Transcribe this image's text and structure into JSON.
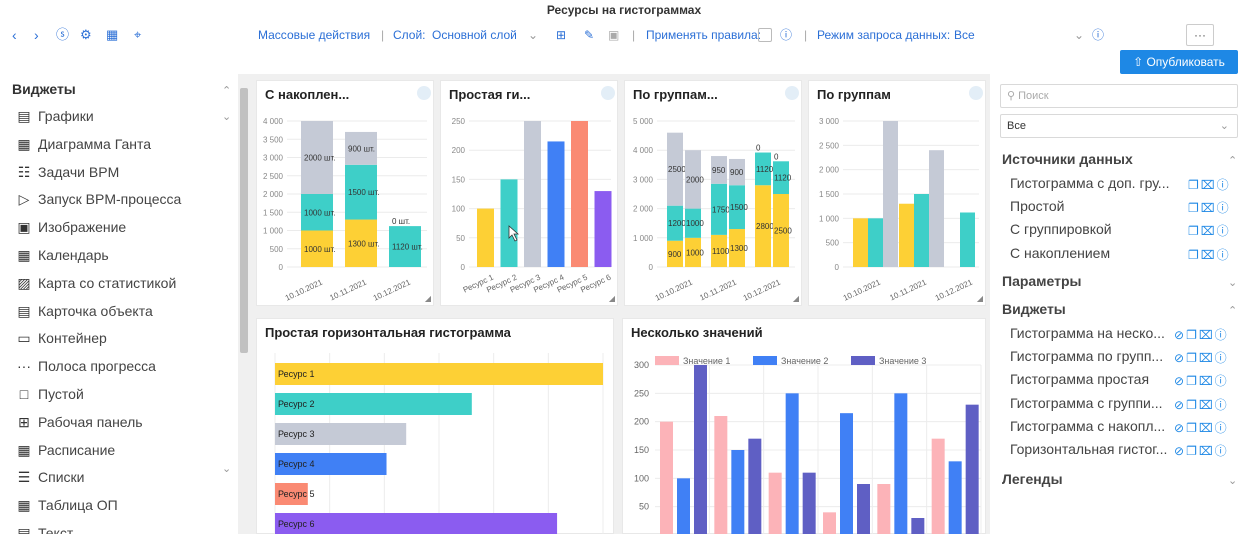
{
  "window": {
    "title": "Ресурсы на гистограммах"
  },
  "toolbar": {
    "bulk_actions": "Массовые действия",
    "layer_label": "Слой:",
    "layer_value": "Основной слой",
    "apply_rules": "Применять правила:",
    "query_mode_label": "Режим запроса данных:",
    "query_mode_value": "Все",
    "more": "···",
    "publish": "Опубликовать"
  },
  "widgets_panel": {
    "title": "Виджеты",
    "items": [
      {
        "label": "Графики",
        "icon": "chart-icon"
      },
      {
        "label": "Диаграмма Ганта",
        "icon": "gantt-icon"
      },
      {
        "label": "Задачи BPM",
        "icon": "tasks-icon"
      },
      {
        "label": "Запуск BPM-процесса",
        "icon": "play-icon"
      },
      {
        "label": "Изображение",
        "icon": "image-icon"
      },
      {
        "label": "Календарь",
        "icon": "calendar-icon"
      },
      {
        "label": "Карта со статистикой",
        "icon": "map-icon"
      },
      {
        "label": "Карточка объекта",
        "icon": "card-icon"
      },
      {
        "label": "Контейнер",
        "icon": "container-icon"
      },
      {
        "label": "Полоса прогресса",
        "icon": "progress-icon"
      },
      {
        "label": "Пустой",
        "icon": "empty-icon"
      },
      {
        "label": "Рабочая панель",
        "icon": "dashboard-icon"
      },
      {
        "label": "Расписание",
        "icon": "schedule-icon"
      },
      {
        "label": "Списки",
        "icon": "list-icon"
      },
      {
        "label": "Таблица ОП",
        "icon": "table-icon"
      },
      {
        "label": "Текст",
        "icon": "text-icon"
      }
    ]
  },
  "right_panel": {
    "search_placeholder": "Поиск",
    "filter_value": "Все",
    "sources_title": "Источники данных",
    "sources": [
      "Гистограмма с доп. гру...",
      "Простой",
      "С группировкой",
      "С накоплением"
    ],
    "params_title": "Параметры",
    "widgets_title": "Виджеты",
    "widgets": [
      "Гистограмма на неско...",
      "Гистограмма по групп...",
      "Гистограмма простая",
      "Гистограмма с группи...",
      "Гистограмма с накопл...",
      "Горизонтальная гистог..."
    ],
    "legends_title": "Легенды"
  },
  "colors": {
    "yellow": "#fdd035",
    "teal": "#3ecfc8",
    "gray": "#c5cad6",
    "blue": "#4080f5",
    "salmon": "#fa8a73",
    "purple": "#8b5cf0",
    "pink": "#fcb3b8",
    "indigo": "#5f5fc4",
    "accent": "#1e88e5"
  },
  "chart_data": [
    {
      "type": "bar",
      "title": "С накоплен...",
      "stacked": true,
      "categories": [
        "10.10.2021",
        "10.11.2021",
        "10.12.2021"
      ],
      "ylim": [
        0,
        4000
      ],
      "yticks": [
        0,
        500,
        1000,
        1500,
        2000,
        2500,
        3000,
        3500,
        4000
      ],
      "series": [
        {
          "color": "#fdd035",
          "values": [
            1000,
            1300,
            0
          ],
          "labels": [
            "1000 шт.",
            "1300 шт.",
            "0 шт."
          ]
        },
        {
          "color": "#3ecfc8",
          "values": [
            1000,
            1500,
            1120
          ],
          "labels": [
            "1000 шт.",
            "1500 шт.",
            "1120 шт."
          ]
        },
        {
          "color": "#c5cad6",
          "values": [
            2000,
            900,
            0
          ],
          "labels": [
            "2000 шт.",
            "900 шт.",
            "0 шт."
          ]
        }
      ]
    },
    {
      "type": "bar",
      "title": "Простая ги...",
      "categories": [
        "Ресурс 1",
        "Ресурс 2",
        "Ресурс 3",
        "Ресурс 4",
        "Ресурс 5",
        "Ресурс 6"
      ],
      "ylim": [
        0,
        250
      ],
      "yticks": [
        0,
        50,
        100,
        150,
        200,
        250
      ],
      "values": [
        100,
        150,
        250,
        215,
        250,
        130
      ],
      "colors": [
        "#fdd035",
        "#3ecfc8",
        "#c5cad6",
        "#4080f5",
        "#fa8a73",
        "#8b5cf0"
      ]
    },
    {
      "type": "bar",
      "title": "По группам...",
      "stacked": true,
      "grouped": true,
      "categories": [
        "10.10.2021",
        "10.11.2021",
        "10.12.2021"
      ],
      "ylim": [
        0,
        5000
      ],
      "yticks": [
        0,
        1000,
        2000,
        3000,
        4000,
        5000
      ],
      "groups": [
        [
          {
            "yellow": 900,
            "teal": 1200,
            "gray": 2500
          },
          {
            "yellow": 1000,
            "teal": 1000,
            "gray": 2000
          }
        ],
        [
          {
            "yellow": 1100,
            "teal": 1750,
            "gray": 950
          },
          {
            "yellow": 1300,
            "teal": 1500,
            "gray": 900
          }
        ],
        [
          {
            "yellow": 2800,
            "teal": 1120,
            "gray": 0
          },
          {
            "yellow": 2500,
            "teal": 1120,
            "gray": 0
          }
        ]
      ]
    },
    {
      "type": "bar",
      "title": "По группам",
      "grouped": true,
      "categories": [
        "10.10.2021",
        "10.11.2021",
        "10.12.2021"
      ],
      "ylim": [
        0,
        3000
      ],
      "yticks": [
        0,
        500,
        1000,
        1500,
        2000,
        2500,
        3000
      ],
      "series": [
        {
          "color": "#fdd035",
          "values": [
            1000,
            1300,
            0
          ]
        },
        {
          "color": "#3ecfc8",
          "values": [
            1000,
            1500,
            1120
          ]
        },
        {
          "color": "#c5cad6",
          "values": [
            3000,
            2400,
            0
          ]
        }
      ]
    },
    {
      "type": "bar",
      "orientation": "horizontal",
      "title": "Простая горизонтальная гистограмма",
      "categories": [
        "Ресурс 1",
        "Ресурс 2",
        "Ресурс 3",
        "Ресурс 4",
        "Ресурс 5",
        "Ресурс 6"
      ],
      "values": [
        250,
        150,
        100,
        85,
        25,
        215
      ],
      "xlim": [
        0,
        250
      ],
      "colors": [
        "#fdd035",
        "#3ecfc8",
        "#c5cad6",
        "#4080f5",
        "#fa8a73",
        "#8b5cf0"
      ]
    },
    {
      "type": "bar",
      "title": "Несколько значений",
      "ylim": [
        0,
        300
      ],
      "yticks": [
        50,
        100,
        150,
        200,
        250,
        300
      ],
      "series": [
        {
          "name": "Значение 1",
          "color": "#fcb3b8",
          "values": [
            200,
            210,
            110,
            40,
            90,
            170
          ]
        },
        {
          "name": "Значение 2",
          "color": "#4080f5",
          "values": [
            100,
            150,
            250,
            215,
            250,
            130
          ]
        },
        {
          "name": "Значение 3",
          "color": "#5f5fc4",
          "values": [
            300,
            170,
            110,
            90,
            30,
            230
          ]
        }
      ]
    }
  ]
}
